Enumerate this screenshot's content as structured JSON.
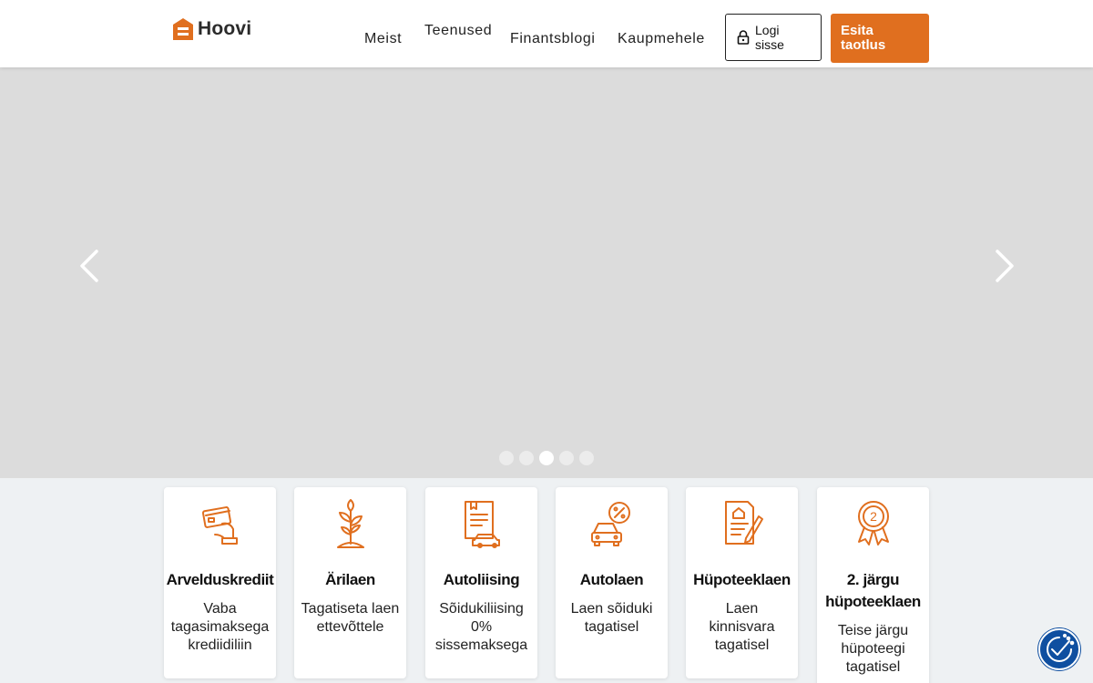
{
  "brand": {
    "name": "Hoovi",
    "accent_color": "#e06f1f"
  },
  "nav": {
    "items": [
      "Meist",
      "Teenused",
      "Finantsblogi",
      "Kaupmehele"
    ],
    "login_label": "Logi sisse",
    "apply_label": "Esita taotlus",
    "login_icon": "lock-icon"
  },
  "carousel": {
    "slide_count": 5,
    "active_index": 2,
    "prev_icon": "chevron-left-icon",
    "next_icon": "chevron-right-icon"
  },
  "cards": [
    {
      "title": "Arvelduskrediit",
      "desc": "Vaba tagasimaksega krediidiliin",
      "icon": "card-in-hand-icon"
    },
    {
      "title": "Ärilaen",
      "desc": "Tagatiseta laen ettevõttele",
      "icon": "sprout-icon"
    },
    {
      "title": "Autoliising",
      "desc": "Sõidukiliising 0% sissemaksega",
      "icon": "car-document-icon"
    },
    {
      "title": "Autolaen",
      "desc": "Laen sõiduki tagatisel",
      "icon": "car-percent-icon"
    },
    {
      "title": "Hüpoteeklaen",
      "desc": "Laen kinnisvara tagatisel",
      "icon": "house-contract-icon"
    },
    {
      "title": "2. järgu hüpoteeklaen",
      "desc": "Teise järgu hüpoteegi tagatisel",
      "icon": "medal-2-icon"
    }
  ],
  "accessibility": {
    "icon": "accessibility-icon",
    "color": "#0f4fa0"
  }
}
